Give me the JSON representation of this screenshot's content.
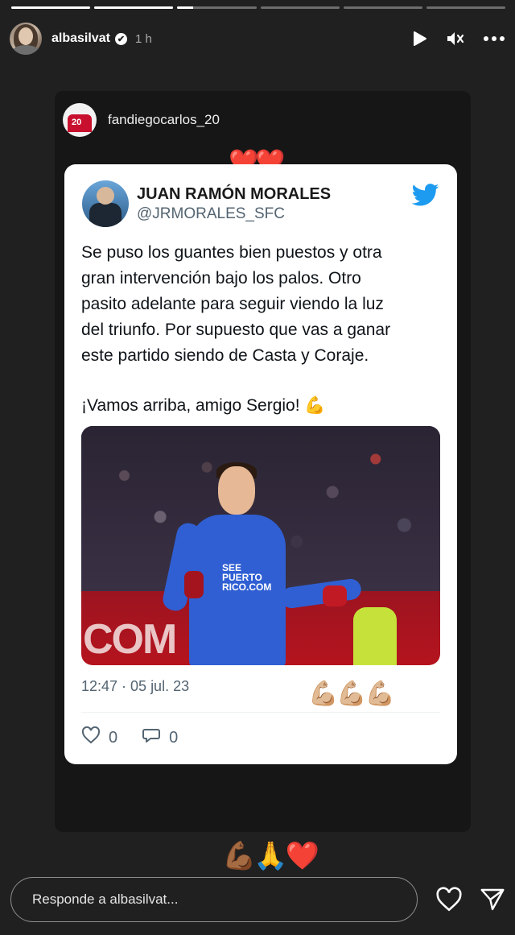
{
  "progress": [
    1,
    1,
    0.2,
    0,
    0,
    0
  ],
  "header": {
    "username": "albasilvat",
    "verified_mark": "✔",
    "time": "1 h",
    "icons": [
      "play-icon",
      "mute-icon",
      "more-icon"
    ]
  },
  "repost": {
    "username": "fandiegocarlos_20",
    "avatar_number": "20"
  },
  "stickers": {
    "top_hearts": "❤️❤️",
    "tweet_flex": "💪🏼💪🏼💪🏼",
    "bottom_row": "💪🏾🙏❤️"
  },
  "tweet": {
    "name": "JUAN RAMÓN MORALES",
    "handle": "@JRMORALES_SFC",
    "body_line1": "Se puso los guantes bien puestos y otra",
    "body_line2": "gran intervención bajo los palos. Otro",
    "body_line3": "pasito adelante para seguir viendo la luz",
    "body_line4": "del triunfo. Por supuesto que vas a ganar",
    "body_line5": "este partido siendo de Casta y Coraje.",
    "body_line6": "¡Vamos arriba, amigo Sergio! 💪",
    "photo_board_text": "COM",
    "photo_shirt_text": "SEE PUERTO RICO.COM",
    "timestamp": "12:47 · 05 jul. 23",
    "likes": "0",
    "replies": "0"
  },
  "reply_bar": {
    "placeholder": "Responde a albasilvat..."
  },
  "colors": {
    "background": "#202020",
    "twitter_blue": "#1d9bf0",
    "text_muted": "#536471"
  }
}
